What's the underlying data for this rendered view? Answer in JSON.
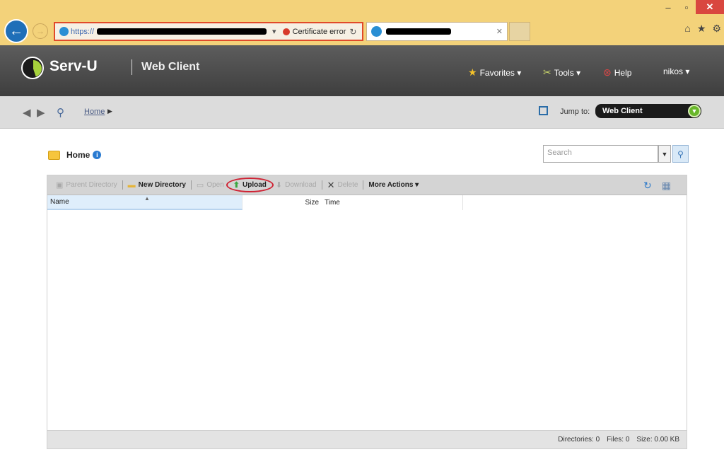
{
  "browser": {
    "url_prefix": "https://",
    "cert_error": "Certificate error",
    "controls": {
      "minimize": "–",
      "restore": "▫",
      "close": "✕"
    },
    "icons": [
      "home-icon",
      "star-icon",
      "gear-icon"
    ]
  },
  "app": {
    "brand": "Serv-U",
    "subtitle": "Web Client",
    "menu": {
      "favorites": "Favorites ▾",
      "tools": "Tools ▾",
      "help": "Help",
      "user": "nikos ▾"
    }
  },
  "subbar": {
    "breadcrumb": "Home",
    "jump_label": "Jump to:",
    "jump_value": "Web Client"
  },
  "folder": {
    "name": "Home",
    "search_placeholder": "Search"
  },
  "actions": {
    "parent_directory": "Parent Directory",
    "new_directory": "New Directory",
    "open": "Open",
    "upload": "Upload",
    "download": "Download",
    "delete": "Delete",
    "more_actions": "More Actions ▾"
  },
  "columns": {
    "name": "Name",
    "size": "Size",
    "time": "Time"
  },
  "status": {
    "directories": "Directories: 0",
    "files": "Files: 0",
    "size": "Size: 0.00 KB"
  },
  "colors": {
    "chrome": "#f3d27a",
    "header": "#4d4d4d",
    "accent_green": "#69b72a",
    "highlight_red": "#cf2233"
  }
}
